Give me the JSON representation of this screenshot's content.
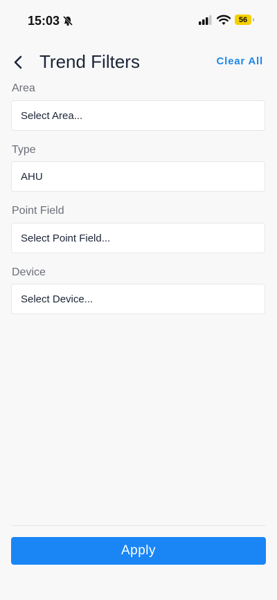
{
  "status_bar": {
    "time": "15:03",
    "battery_level": "56",
    "icons": [
      "bell-off-icon",
      "signal-icon",
      "wifi-icon",
      "battery-icon"
    ]
  },
  "header": {
    "title": "Trend Filters",
    "clear_all_label": "Clear All",
    "back_icon": "chevron-left-icon"
  },
  "filters": [
    {
      "label": "Area",
      "value": "Select Area..."
    },
    {
      "label": "Type",
      "value": "AHU"
    },
    {
      "label": "Point Field",
      "value": "Select Point Field..."
    },
    {
      "label": "Device",
      "value": "Select Device..."
    }
  ],
  "footer": {
    "apply_label": "Apply"
  },
  "colors": {
    "accent": "#1a86f5",
    "battery": "#f5d000",
    "background": "#f8f8f9"
  }
}
